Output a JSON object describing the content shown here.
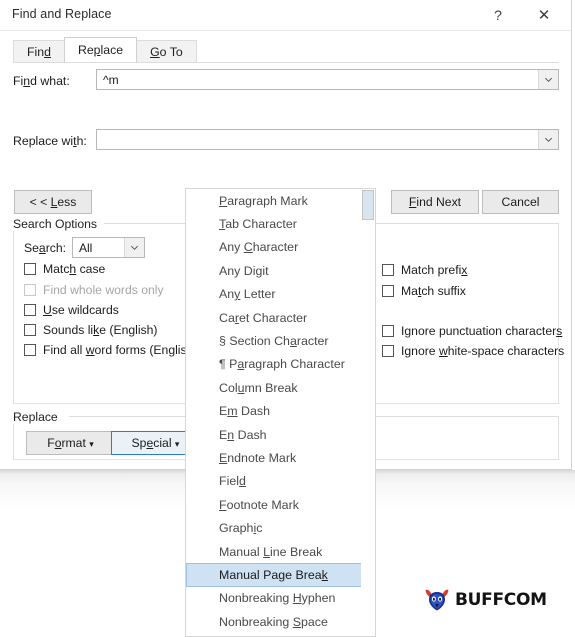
{
  "window": {
    "title": "Find and Replace",
    "help_icon": "?",
    "close_icon": "✕"
  },
  "tabs": [
    {
      "label": "Find",
      "accel_index": 3,
      "active": false,
      "name": "tab-find"
    },
    {
      "label": "Replace",
      "accel_index": 2,
      "active": true,
      "name": "tab-replace"
    },
    {
      "label": "Go To",
      "accel_index": 1,
      "active": false,
      "name": "tab-go-to"
    }
  ],
  "fields": {
    "find_what": {
      "label": "Find what:",
      "value": "^m",
      "placeholder": ""
    },
    "replace_with": {
      "label": "Replace with:",
      "value": "",
      "placeholder": ""
    }
  },
  "buttons": {
    "less": "< < Less",
    "find_next": "Find Next",
    "cancel": "Cancel",
    "format": "Format ▾",
    "special": "Special ▾"
  },
  "search_options": {
    "group_title": "Search Options",
    "search_label": "Search:",
    "search_value": "All",
    "left_checks": [
      {
        "label": "Match case",
        "checked": false,
        "disabled": false,
        "name": "checkbox-match-case"
      },
      {
        "label": "Find whole words only",
        "checked": false,
        "disabled": true,
        "name": "checkbox-find-whole-words-only"
      },
      {
        "label": "Use wildcards",
        "checked": false,
        "disabled": false,
        "name": "checkbox-use-wildcards"
      },
      {
        "label": "Sounds like (English)",
        "checked": false,
        "disabled": false,
        "name": "checkbox-sounds-like"
      },
      {
        "label": "Find all word forms (English)",
        "checked": false,
        "disabled": false,
        "name": "checkbox-find-all-word-forms"
      }
    ],
    "right_checks": [
      {
        "label": "Match prefix",
        "checked": false,
        "name": "checkbox-match-prefix"
      },
      {
        "label": "Match suffix",
        "checked": false,
        "name": "checkbox-match-suffix"
      },
      {
        "label": "Ignore punctuation characters",
        "checked": false,
        "name": "checkbox-ignore-punctuation"
      },
      {
        "label": "Ignore white-space characters",
        "checked": false,
        "name": "checkbox-ignore-white-space"
      }
    ]
  },
  "replace_group": {
    "group_title": "Replace"
  },
  "special_menu": {
    "selected": "Manual Page Break",
    "items": [
      "Paragraph Mark",
      "Tab Character",
      "Any Character",
      "Any Digit",
      "Any Letter",
      "Caret Character",
      "§ Section Character",
      "¶ Paragraph Character",
      "Column Break",
      "Em Dash",
      "En Dash",
      "Endnote Mark",
      "Field",
      "Footnote Mark",
      "Graphic",
      "Manual Line Break",
      "Manual Page Break",
      "Nonbreaking Hyphen",
      "Nonbreaking Space"
    ]
  },
  "brand": {
    "text": "BUFFCOM",
    "icon": "bull-head-icon"
  },
  "colors": {
    "accent": "#2f7dba",
    "menu_highlight": "#cfe2f3",
    "menu_highlight_border": "#9fc2e0",
    "dialog_bg": "#ffffff",
    "button_bg": "#eaeaea"
  }
}
